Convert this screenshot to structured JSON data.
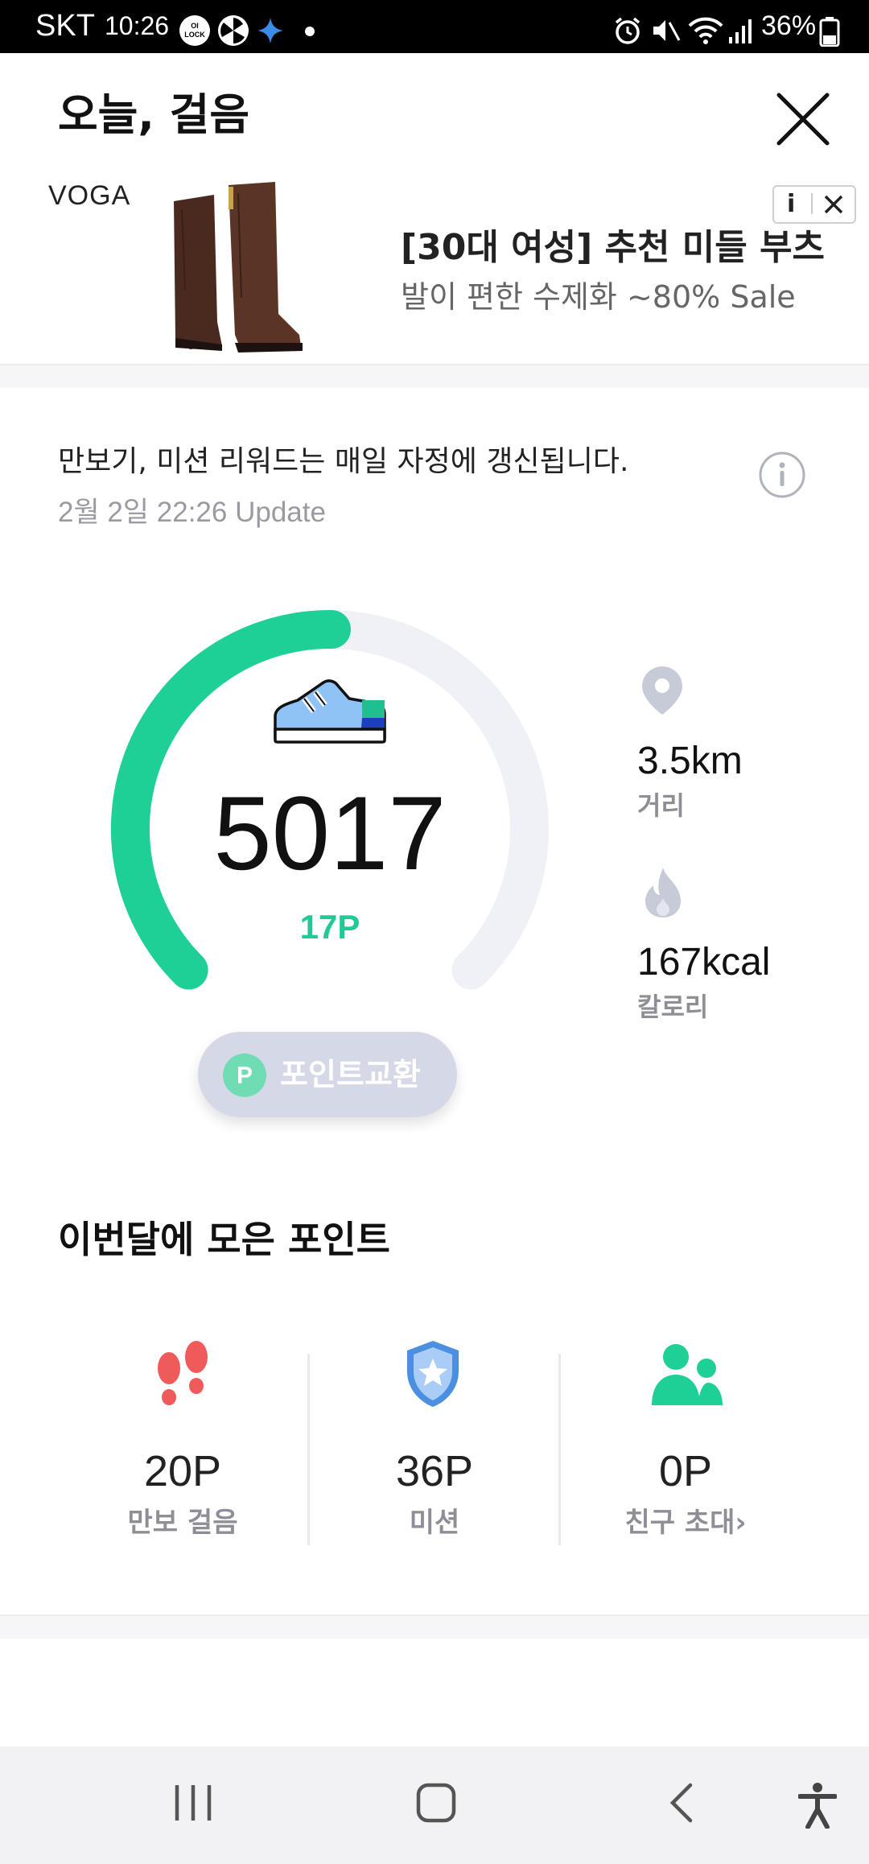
{
  "status_bar": {
    "carrier": "SKT",
    "time": "10:26",
    "lock_badge": "OI LOCK",
    "battery": "36%"
  },
  "header": {
    "title": "오늘, 걸음"
  },
  "ad": {
    "brand": "VOGA",
    "info_label": "i",
    "title": "[30대 여성] 추천 미들 부츠",
    "subtitle": "발이 편한 수제화 ~80% Sale"
  },
  "notice": {
    "text": "만보기, 미션 리워드는 매일 자정에 갱신됩니다.",
    "updated": "2월 2일 22:26 Update"
  },
  "pedometer": {
    "steps": "5017",
    "points": "17P",
    "progress_fraction": 0.5017,
    "goal_steps": 10000,
    "accent_color": "#1ecf96",
    "track_color": "#f0f1f6"
  },
  "stats": {
    "distance_value": "3.5km",
    "distance_label": "거리",
    "calorie_value": "167kcal",
    "calorie_label": "칼로리"
  },
  "exchange_button": {
    "badge": "P",
    "label": "포인트교환"
  },
  "monthly": {
    "title": "이번달에 모은 포인트",
    "columns": [
      {
        "value": "20P",
        "label": "만보 걸음",
        "icon": "footprints-icon"
      },
      {
        "value": "36P",
        "label": "미션",
        "icon": "shield-star-icon"
      },
      {
        "value": "0P",
        "label": "친구 초대",
        "icon": "friends-icon"
      }
    ],
    "invite_arrow": "›"
  }
}
